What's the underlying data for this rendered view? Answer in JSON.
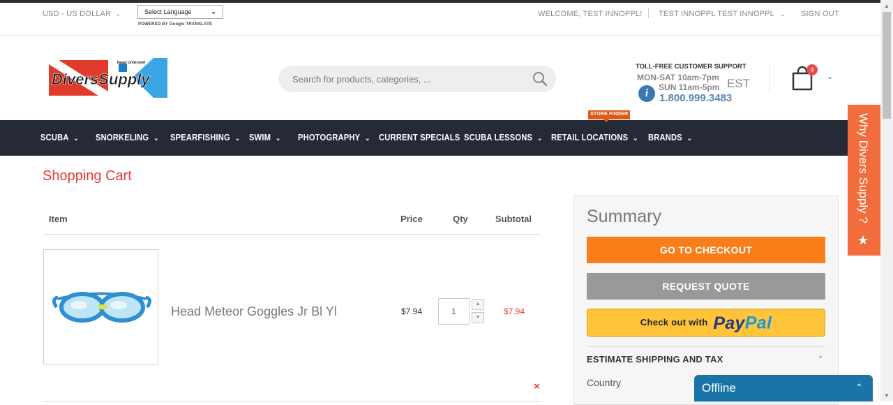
{
  "topbar": {
    "currency": "USD - US DOLLAR",
    "language_select": "Select Language",
    "powered_by": "POWERED BY Google TRANSLATE",
    "welcome": "WELCOME, TEST INNOPPL!",
    "account": "TEST INNOPPL TEST INNOPPL",
    "sign_out": "SIGN OUT"
  },
  "header": {
    "logo_text": "DiversSupply",
    "logo_tagline": "Never Undersold",
    "search_placeholder": "Search for products, categories, ...",
    "support_title": "TOLL-FREE CUSTOMER SUPPORT",
    "support_hours1": "MON-SAT 10am-7pm",
    "support_hours2": "SUN 11am-5pm",
    "support_tz": "EST",
    "support_phone": "1.800.999.3483",
    "cart_count": "4"
  },
  "nav": {
    "items": [
      "SCUBA",
      "SNORKELING",
      "SPEARFISHING",
      "SWIM",
      "PHOTOGRAPHY",
      "CURRENT SPECIALS",
      "SCUBA LESSONS",
      "RETAIL LOCATIONS",
      "BRANDS"
    ],
    "store_finder": "STORE FINDER"
  },
  "cart": {
    "title": "Shopping Cart",
    "headers": {
      "item": "Item",
      "price": "Price",
      "qty": "Qty",
      "subtotal": "Subtotal"
    },
    "items": [
      {
        "name": "Head Meteor Goggles Jr Bl Yl",
        "price": "$7.94",
        "qty": "1",
        "subtotal": "$7.94"
      }
    ],
    "remove_icon": "×"
  },
  "summary": {
    "title": "Summary",
    "checkout": "GO TO CHECKOUT",
    "quote": "REQUEST QUOTE",
    "paypal_prefix": "Check out with",
    "paypal_brand_1": "Pay",
    "paypal_brand_2": "Pal",
    "estimate_title": "ESTIMATE SHIPPING AND TAX",
    "country_label": "Country"
  },
  "side_tab": {
    "label": "Why Divers Supply ?",
    "star": "★"
  },
  "chat": {
    "status": "Offline",
    "chevron": "⌃"
  },
  "colors": {
    "accent_red": "#e83a3a",
    "nav_bg": "#262a37",
    "checkout_orange": "#f97e1a",
    "side_tab": "#f26d3d",
    "chat_blue": "#1b74a8"
  }
}
